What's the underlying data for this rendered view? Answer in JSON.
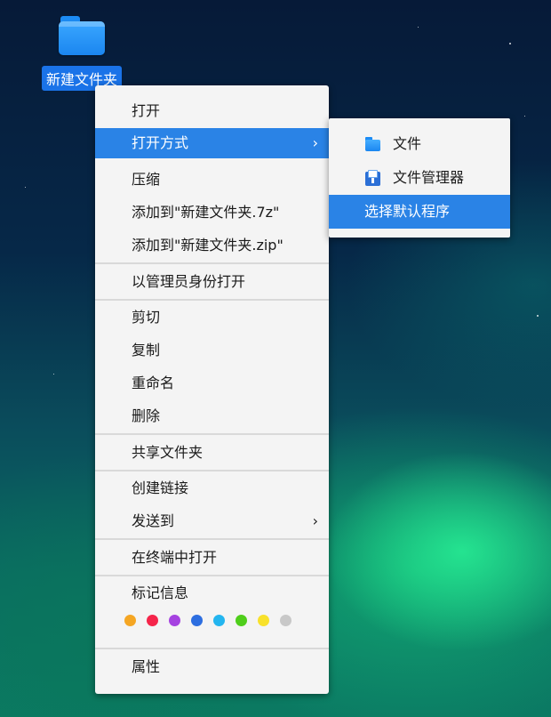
{
  "desktop": {
    "folder_label": "新建文件夹"
  },
  "menu": {
    "items": [
      {
        "label": "打开"
      },
      {
        "label": "打开方式",
        "submenu": true
      },
      {
        "label": "压缩"
      },
      {
        "label": "添加到\"新建文件夹.7z\""
      },
      {
        "label": "添加到\"新建文件夹.zip\""
      },
      {
        "label": "以管理员身份打开"
      },
      {
        "label": "剪切"
      },
      {
        "label": "复制"
      },
      {
        "label": "重命名"
      },
      {
        "label": "删除"
      },
      {
        "label": "共享文件夹"
      },
      {
        "label": "创建链接"
      },
      {
        "label": "发送到",
        "submenu": true
      },
      {
        "label": "在终端中打开"
      },
      {
        "label": "标记信息"
      },
      {
        "label": "属性"
      }
    ],
    "arrow": "›",
    "tag_colors": [
      "#f5a623",
      "#f5254a",
      "#a542e0",
      "#2d6ee0",
      "#23b5ef",
      "#4fce1b",
      "#f8e12b",
      "#c8c8c8"
    ]
  },
  "submenu": {
    "items": [
      {
        "label": "文件",
        "icon": "folder-icon"
      },
      {
        "label": "文件管理器",
        "icon": "file-manager-icon"
      },
      {
        "label": "选择默认程序"
      }
    ]
  },
  "colors": {
    "highlight": "#2a83e6"
  }
}
